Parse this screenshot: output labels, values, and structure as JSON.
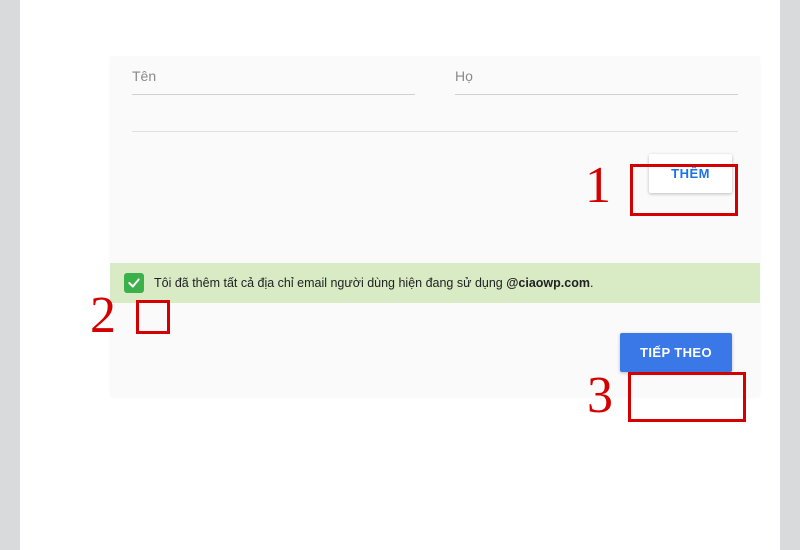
{
  "fields": {
    "first_name_label": "Tên",
    "last_name_label": "Họ"
  },
  "buttons": {
    "add": "THÊM",
    "next": "TIẾP THEO"
  },
  "confirm": {
    "text_before": "Tôi đã thêm tất cả địa chỉ email người dùng hiện đang sử dụng ",
    "domain_bold": "@ciaowp.com",
    "text_after": "."
  },
  "annotations": {
    "n1": "1",
    "n2": "2",
    "n3": "3"
  }
}
